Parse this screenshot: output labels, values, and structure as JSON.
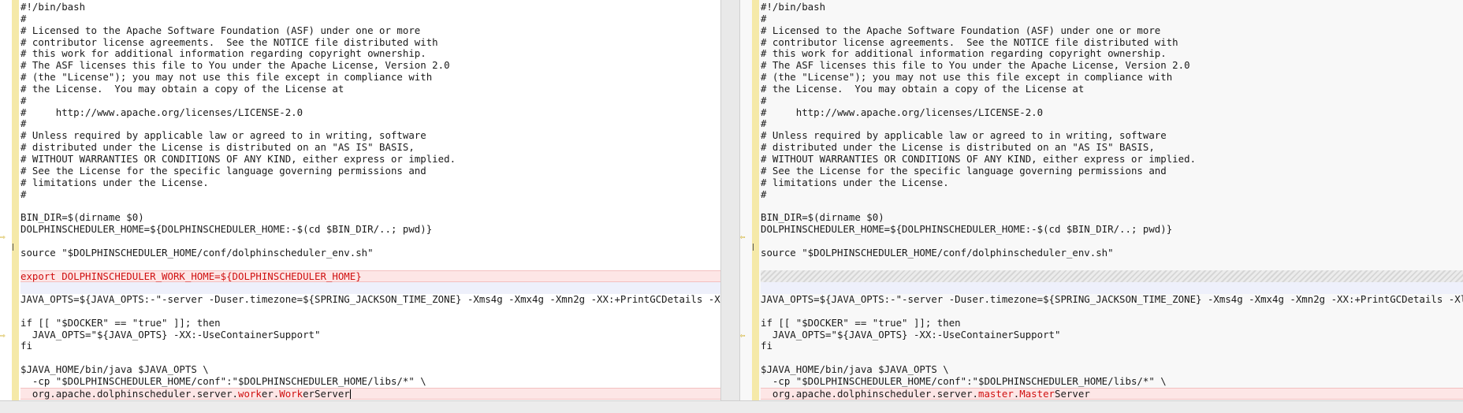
{
  "left": {
    "lines": [
      "#!/bin/bash",
      "#",
      "# Licensed to the Apache Software Foundation (ASF) under one or more",
      "# contributor license agreements.  See the NOTICE file distributed with",
      "# this work for additional information regarding copyright ownership.",
      "# The ASF licenses this file to You under the Apache License, Version 2.0",
      "# (the \"License\"); you may not use this file except in compliance with",
      "# the License.  You may obtain a copy of the License at",
      "#",
      "#     http://www.apache.org/licenses/LICENSE-2.0",
      "#",
      "# Unless required by applicable law or agreed to in writing, software",
      "# distributed under the License is distributed on an \"AS IS\" BASIS,",
      "# WITHOUT WARRANTIES OR CONDITIONS OF ANY KIND, either express or implied.",
      "# See the License for the specific language governing permissions and",
      "# limitations under the License.",
      "#",
      "",
      "BIN_DIR=$(dirname $0)",
      "DOLPHINSCHEDULER_HOME=${DOLPHINSCHEDULER_HOME:-$(cd $BIN_DIR/..; pwd)}",
      "",
      "source \"$DOLPHINSCHEDULER_HOME/conf/dolphinscheduler_env.sh\"",
      "",
      "export DOLPHINSCHEDULER_WORK_HOME=${DOLPHINSCHEDULER_HOME}",
      "",
      "JAVA_OPTS=${JAVA_OPTS:-\"-server -Duser.timezone=${SPRING_JACKSON_TIME_ZONE} -Xms4g -Xmx4g -Xmn2g -XX:+PrintGCDetails -Xlogg",
      "",
      "if [[ \"$DOCKER\" == \"true\" ]]; then",
      "  JAVA_OPTS=\"${JAVA_OPTS} -XX:-UseContainerSupport\"",
      "fi",
      "",
      "$JAVA_HOME/bin/java $JAVA_OPTS \\",
      "  -cp \"$DOLPHINSCHEDULER_HOME/conf\":\"$DOLPHINSCHEDULER_HOME/libs/*\" \\"
    ],
    "last_line": {
      "prefix": "  org.apache.dolphinscheduler.server.",
      "hl1": "work",
      "mid": "er.",
      "hl2": "Work",
      "suffix": "erServer"
    }
  },
  "right": {
    "lines": [
      "#!/bin/bash",
      "#",
      "# Licensed to the Apache Software Foundation (ASF) under one or more",
      "# contributor license agreements.  See the NOTICE file distributed with",
      "# this work for additional information regarding copyright ownership.",
      "# The ASF licenses this file to You under the Apache License, Version 2.0",
      "# (the \"License\"); you may not use this file except in compliance with",
      "# the License.  You may obtain a copy of the License at",
      "#",
      "#     http://www.apache.org/licenses/LICENSE-2.0",
      "#",
      "# Unless required by applicable law or agreed to in writing, software",
      "# distributed under the License is distributed on an \"AS IS\" BASIS,",
      "# WITHOUT WARRANTIES OR CONDITIONS OF ANY KIND, either express or implied.",
      "# See the License for the specific language governing permissions and",
      "# limitations under the License.",
      "#",
      "",
      "BIN_DIR=$(dirname $0)",
      "DOLPHINSCHEDULER_HOME=${DOLPHINSCHEDULER_HOME:-$(cd $BIN_DIR/..; pwd)}",
      "",
      "source \"$DOLPHINSCHEDULER_HOME/conf/dolphinscheduler_env.sh\"",
      "",
      "",
      "",
      "JAVA_OPTS=${JAVA_OPTS:-\"-server -Duser.timezone=${SPRING_JACKSON_TIME_ZONE} -Xms4g -Xmx4g -Xmn2g -XX:+PrintGCDetails -Xlogg",
      "",
      "if [[ \"$DOCKER\" == \"true\" ]]; then",
      "  JAVA_OPTS=\"${JAVA_OPTS} -XX:-UseContainerSupport\"",
      "fi",
      "",
      "$JAVA_HOME/bin/java $JAVA_OPTS \\",
      "  -cp \"$DOLPHINSCHEDULER_HOME/conf\":\"$DOLPHINSCHEDULER_HOME/libs/*\" \\"
    ],
    "last_line": {
      "prefix": "  org.apache.dolphinscheduler.server.",
      "hl1": "master",
      "mid": ".",
      "hl2": "Master",
      "suffix": "Server"
    }
  },
  "icons": {
    "change_marker_left": "arrow-right-icon",
    "change_marker_right": "arrow-left-icon"
  },
  "colors": {
    "changed_bg": "#fde6e6",
    "changed_text": "#d01010",
    "gutter_strip": "#f5e9a8",
    "right_pane_bg": "#f8f8f8"
  }
}
